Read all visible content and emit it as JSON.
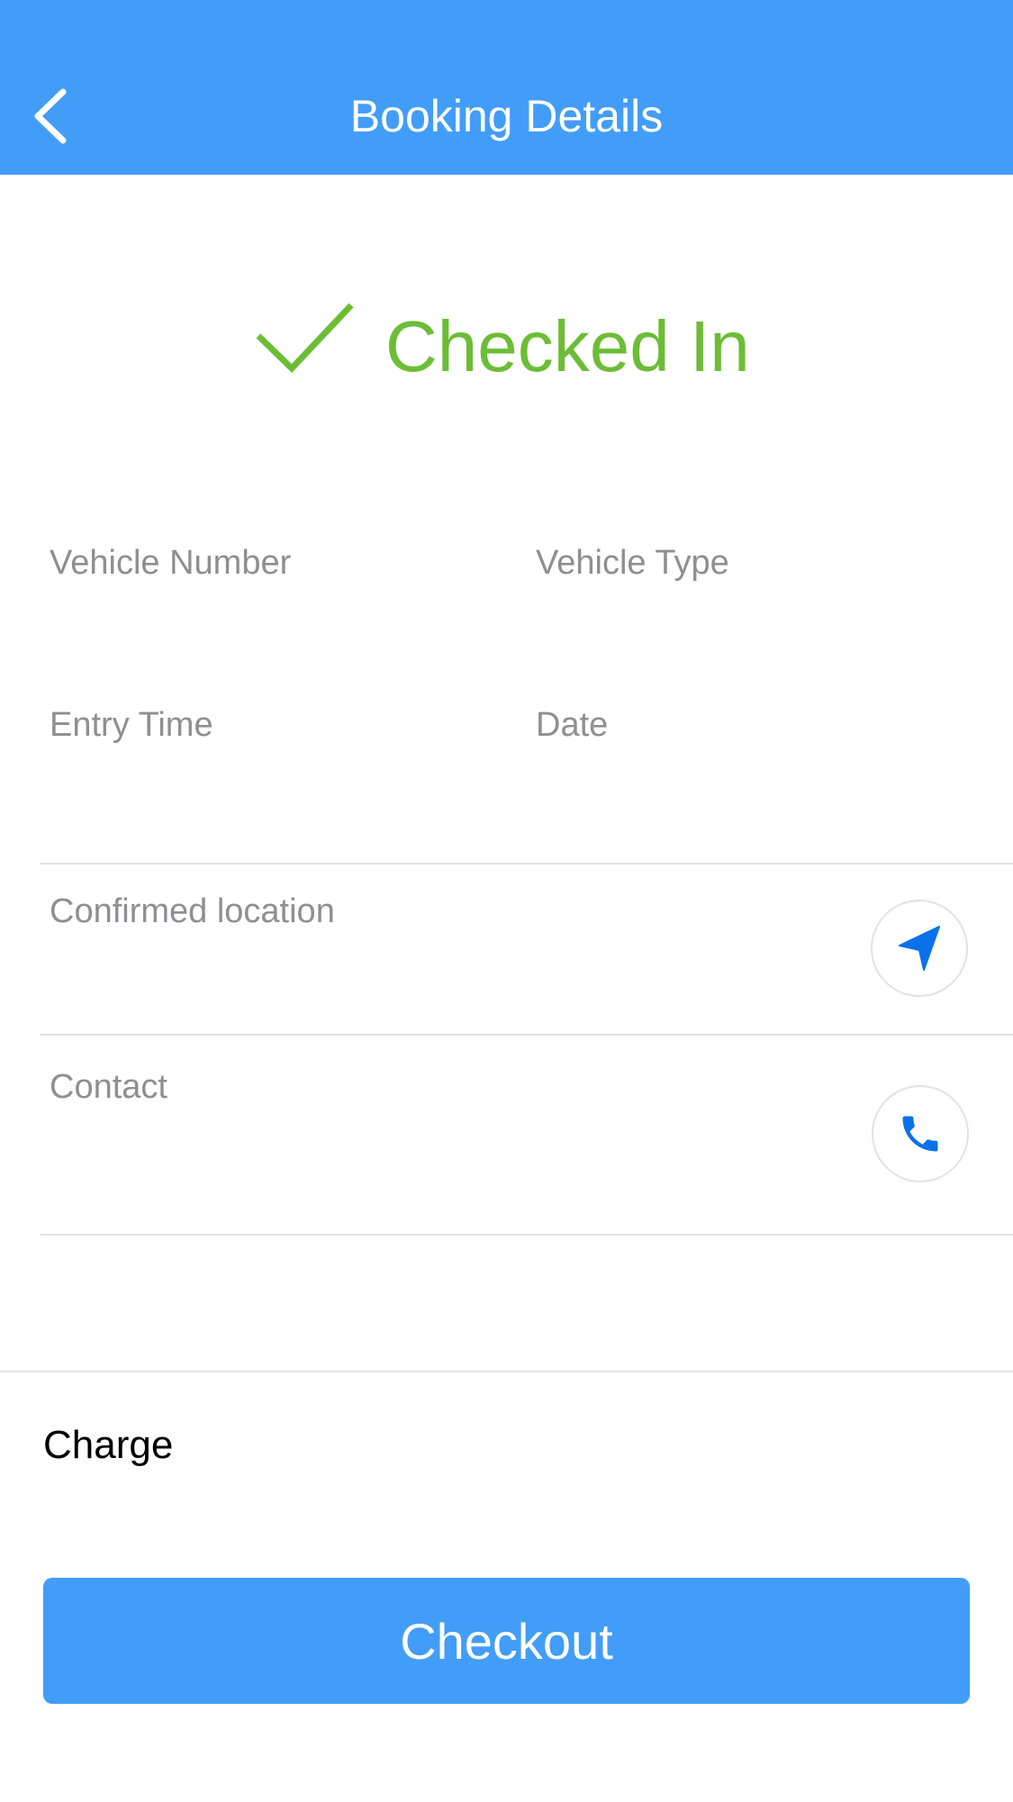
{
  "header": {
    "title": "Booking Details",
    "back_icon": "chevron-left-icon",
    "background_color": "#429DF8"
  },
  "status": {
    "text": "Checked In",
    "icon": "checkmark-icon",
    "color": "#6CBD36"
  },
  "fields": {
    "vehicle_number": {
      "label": "Vehicle Number",
      "value": ""
    },
    "vehicle_type": {
      "label": "Vehicle Type",
      "value": ""
    },
    "entry_time": {
      "label": "Entry Time",
      "value": ""
    },
    "date": {
      "label": "Date",
      "value": ""
    },
    "confirmed_location": {
      "label": "Confirmed location",
      "value": "",
      "action_icon": "navigation-arrow-icon"
    },
    "contact": {
      "label": "Contact",
      "value": "",
      "action_icon": "phone-icon"
    }
  },
  "charge": {
    "label": "Charge",
    "value": ""
  },
  "checkout": {
    "label": "Checkout"
  },
  "colors": {
    "accent": "#429DF8",
    "success": "#6CBD36",
    "icon_blue": "#0A72E8",
    "label_gray": "#8E8E93"
  }
}
